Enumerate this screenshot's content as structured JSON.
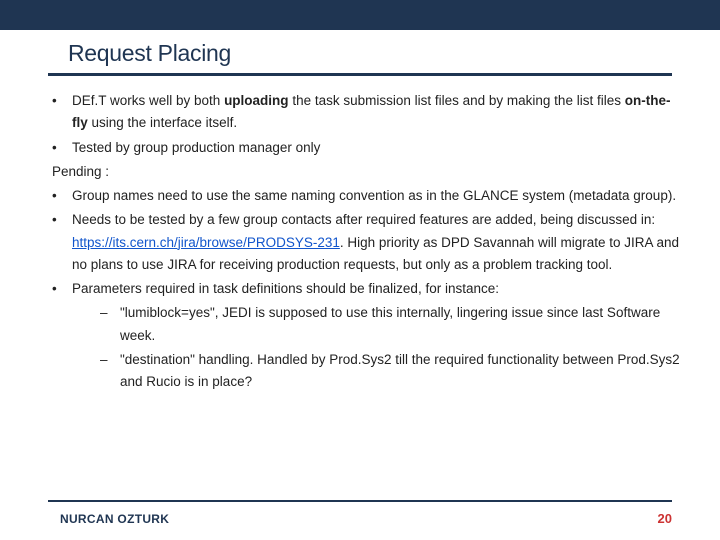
{
  "title": "Request Placing",
  "b1_pre": "DEf.T works well by both ",
  "b1_bold1": "uploading",
  "b1_mid": " the task submission list files and by making the list files ",
  "b1_bold2": "on-the-fly",
  "b1_post": " using the interface itself.",
  "b2": "Tested by group production manager only",
  "pending": "Pending :",
  "b3": "Group names need to use the same naming convention as in the GLANCE system (metadata group).",
  "b4_pre": "Needs to be tested by a few group contacts after required features are added, being discussed in: ",
  "b4_link": "https://its.cern.ch/jira/browse/PRODSYS-231",
  "b4_post": ". High priority as DPD Savannah will migrate to JIRA and no plans to use JIRA for receiving production requests, but only as a problem tracking tool.",
  "b5": "Parameters required in task definitions should be finalized, for instance:",
  "b5a": "\"lumiblock=yes\", JEDI is supposed to use this internally, lingering issue since last Software week.",
  "b5b": "\"destination\" handling. Handled by Prod.Sys2 till the required functionality between Prod.Sys2 and Rucio is in place?",
  "author": "NURCAN OZTURK",
  "page": "20"
}
